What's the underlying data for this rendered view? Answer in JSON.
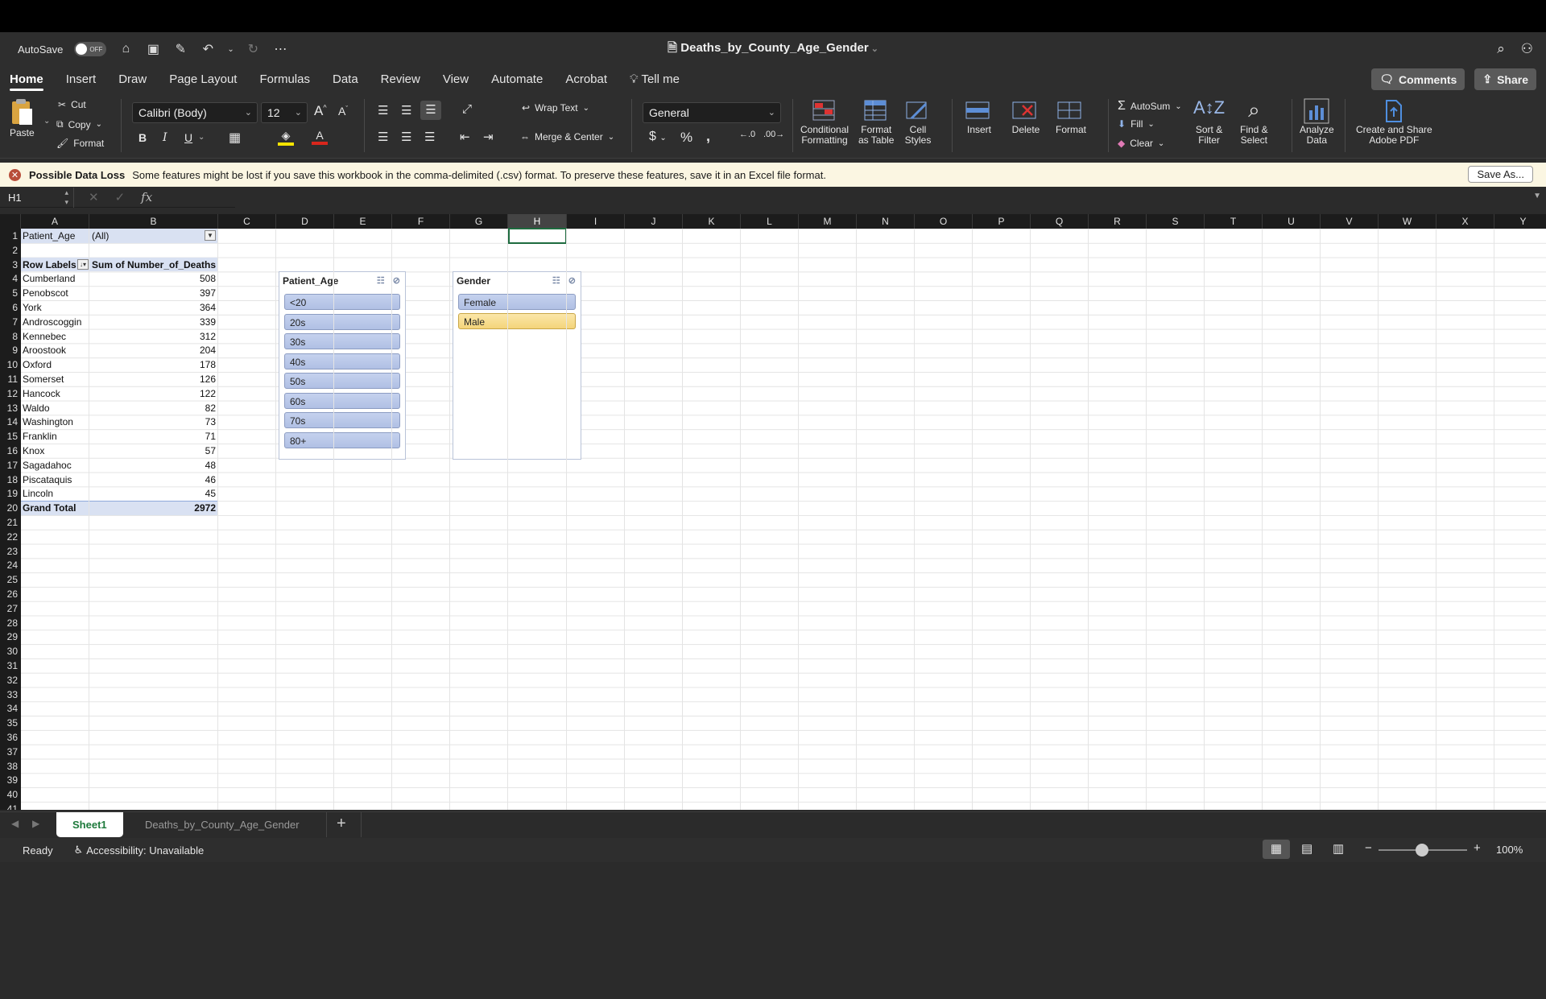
{
  "titlebar": {
    "autosave_label": "AutoSave",
    "autosave_state": "OFF",
    "doc_title": "Deaths_by_County_Age_Gender"
  },
  "tabs": [
    "Home",
    "Insert",
    "Draw",
    "Page Layout",
    "Formulas",
    "Data",
    "Review",
    "View",
    "Automate",
    "Acrobat",
    "Tell me"
  ],
  "tabs_right": {
    "comments": "Comments",
    "share": "Share"
  },
  "ribbon": {
    "paste": "Paste",
    "cut": "Cut",
    "copy": "Copy",
    "format_painter": "Format",
    "font_name": "Calibri (Body)",
    "font_size": "12",
    "bold": "B",
    "italic": "I",
    "underline": "U",
    "wrap_text": "Wrap Text",
    "merge_center": "Merge & Center",
    "number_format": "General",
    "conditional_formatting": "Conditional\nFormatting",
    "format_as_table": "Format\nas Table",
    "cell_styles": "Cell\nStyles",
    "insert": "Insert",
    "delete": "Delete",
    "format": "Format",
    "autosum": "AutoSum",
    "fill": "Fill",
    "clear": "Clear",
    "sort_filter": "Sort &\nFilter",
    "find_select": "Find &\nSelect",
    "analyze_data": "Analyze\nData",
    "create_share_pdf": "Create and Share\nAdobe PDF"
  },
  "warning": {
    "title": "Possible Data Loss",
    "message": "Some features might be lost if you save this workbook in the comma-delimited (.csv) format. To preserve these features, save it in an Excel file format.",
    "button": "Save As..."
  },
  "formula_bar": {
    "name_box": "H1",
    "fx": "fx",
    "content": ""
  },
  "columns": [
    "A",
    "B",
    "C",
    "D",
    "E",
    "F",
    "G",
    "H",
    "I",
    "J",
    "K",
    "L",
    "M",
    "N",
    "O",
    "P",
    "Q",
    "R",
    "S",
    "T",
    "U",
    "V",
    "W",
    "X",
    "Y"
  ],
  "selected_column": "H",
  "pivot": {
    "filter_label": "Patient_Age",
    "filter_value": "(All)",
    "row_labels_header": "Row Labels",
    "values_header": "Sum of Number_of_Deaths",
    "rows": [
      {
        "label": "Cumberland",
        "value": "508"
      },
      {
        "label": "Penobscot",
        "value": "397"
      },
      {
        "label": "York",
        "value": "364"
      },
      {
        "label": "Androscoggin",
        "value": "339"
      },
      {
        "label": "Kennebec",
        "value": "312"
      },
      {
        "label": "Aroostook",
        "value": "204"
      },
      {
        "label": "Oxford",
        "value": "178"
      },
      {
        "label": "Somerset",
        "value": "126"
      },
      {
        "label": "Hancock",
        "value": "122"
      },
      {
        "label": "Waldo",
        "value": "82"
      },
      {
        "label": "Washington",
        "value": "73"
      },
      {
        "label": "Franklin",
        "value": "71"
      },
      {
        "label": "Knox",
        "value": "57"
      },
      {
        "label": "Sagadahoc",
        "value": "48"
      },
      {
        "label": "Piscataquis",
        "value": "46"
      },
      {
        "label": "Lincoln",
        "value": "45"
      }
    ],
    "total_label": "Grand Total",
    "total_value": "2972"
  },
  "slicer_age": {
    "title": "Patient_Age",
    "items": [
      "<20",
      "20s",
      "30s",
      "40s",
      "50s",
      "60s",
      "70s",
      "80+"
    ]
  },
  "slicer_gender": {
    "title": "Gender",
    "items": [
      "Female",
      "Male"
    ],
    "selected": "Male"
  },
  "sheet_tabs": [
    "Sheet1",
    "Deaths_by_County_Age_Gender"
  ],
  "active_sheet": "Sheet1",
  "status": {
    "ready": "Ready",
    "accessibility": "Accessibility: Unavailable",
    "zoom": "100%"
  },
  "colors": {
    "accent_green": "#1e7a3c",
    "pivot_header": "#d9e1f2",
    "slicer_selected": "#f4d47a",
    "warning_bg": "#fbf6e2"
  }
}
